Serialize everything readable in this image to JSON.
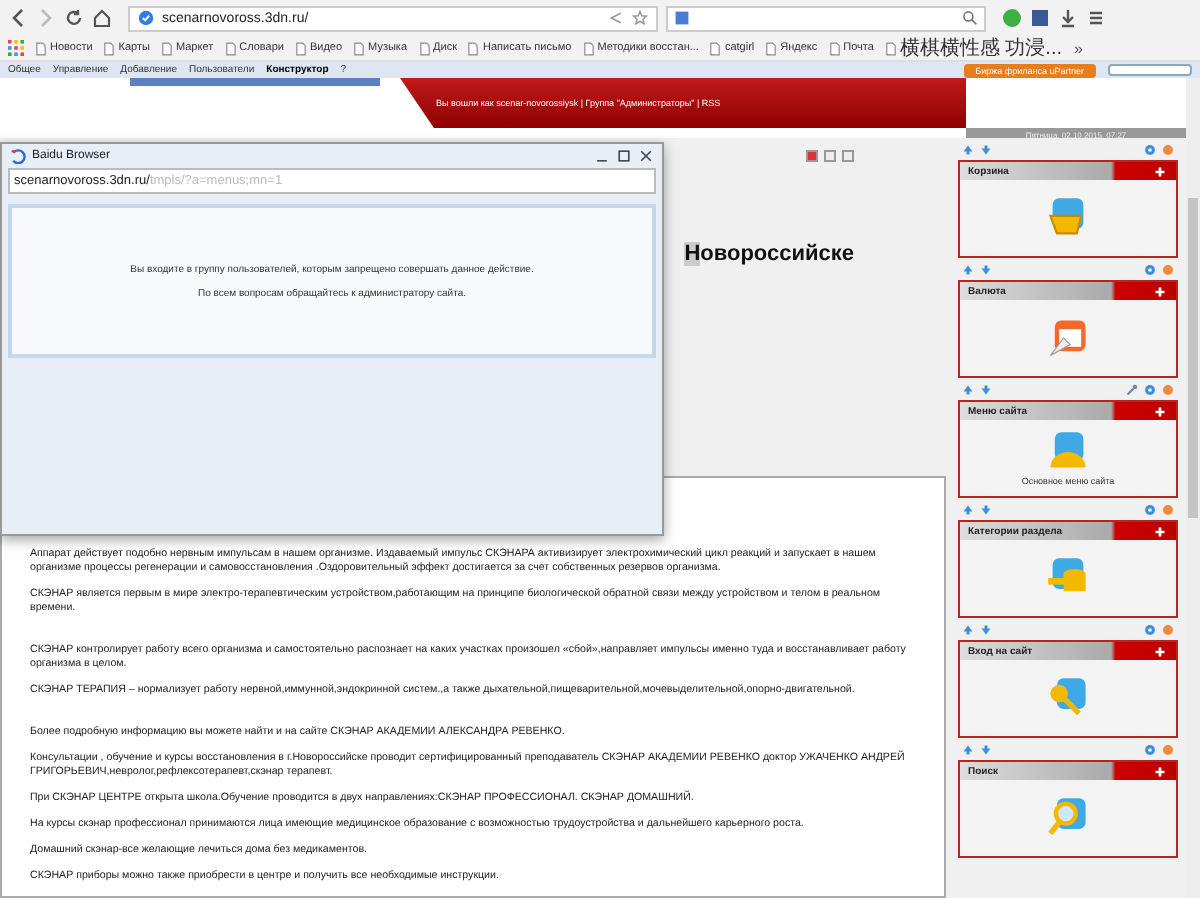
{
  "browser": {
    "url": "scenarnovoross.3dn.ru/",
    "bookmarks": [
      "Новости",
      "Карты",
      "Маркет",
      "Словари",
      "Видео",
      "Музыка",
      "Диск",
      "Написать письмо",
      "Методики восстан...",
      "catgirl",
      "Яндекс",
      "Почта",
      "横棋横性感 功浸..."
    ],
    "more": "»"
  },
  "admin_bar": {
    "items": [
      {
        "label": "Общее",
        "selected": false
      },
      {
        "label": "Управление",
        "selected": false
      },
      {
        "label": "Добавление",
        "selected": false
      },
      {
        "label": "Пользователи",
        "selected": false
      },
      {
        "label": "Конструктор",
        "selected": true
      },
      {
        "label": "?",
        "selected": false
      }
    ],
    "partner_button": "Биржа фриланса uPartner"
  },
  "site_header": {
    "login_text": "Вы вошли как scenar-novorossiysk | Группа \"Администраторы\" | RSS",
    "date": "Пятница, 02.10.2015, 07:27"
  },
  "heading": "Новороссийске",
  "article": {
    "sections": [
      [
        "Аппарат действует подобно нервным импульсам в нашем организме. Издаваемый импульс СКЭНАРА активизирует электрохимический цикл реакций и запускает в нашем организме процессы регенерации и самовосстановления .Оздоровительный эффект достигается за счет собственных резервов организма.",
        "СКЭНАР является первым в мире электро-терапевтическим устройством,работающим на принципе биологической обратной связи между устройством и телом в реальном времени."
      ],
      [
        "СКЭНАР контролирует работу всего организма и самостоятельно распознает на каких участках произошел «сбой»,направляет импульсы именно туда и восстанавливает работу организма в целом.",
        "СКЭНАР ТЕРАПИЯ – нормализует работу нервной,иммунной,эндокринной систем.,а также дыхательной,пищеварительной,мочевыделительной,опорно-двигательной."
      ],
      [
        "Более подробную информацию вы можете найти и на сайте СКЭНАР АКАДЕМИИ АЛЕКСАНДРА РЕВЕНКО.",
        "Консультации , обучение и курсы восстановления в г.Новороссийске проводит сертифицированный преподаватель СКЭНАР АКАДЕМИИ РЕВЕНКО доктор УЖАЧЕНКО АНДРЕЙ ГРИГОРЬЕВИЧ,невролог,рефлексотерапевт,скэнар терапевт.",
        "При СКЭНАР ЦЕНТРЕ открыта школа.Обучение проводится в двух направлениях:СКЭНАР ПРОФЕССИОНАЛ. СКЭНАР ДОМАШНИЙ.",
        "На курсы скэнар профессионал принимаются лица имеющие медицинское образование с возможностью трудоустройства и дальнейшего карьерного роста.",
        "Домашний скэнар-все желающие лечиться дома без медикаментов.",
        "СКЭНАР приборы можно также приобрести в центре и получить все необходимые инструкции."
      ]
    ]
  },
  "sidebar": {
    "blocks": [
      {
        "title": "Корзина",
        "kind": "basket",
        "editable": false
      },
      {
        "title": "Валюта",
        "kind": "currency",
        "editable": false
      },
      {
        "title": "Меню сайта",
        "kind": "menu",
        "editable": true,
        "caption": "Основное меню сайта"
      },
      {
        "title": "Категории раздела",
        "kind": "categories",
        "editable": false
      },
      {
        "title": "Вход на сайт",
        "kind": "login",
        "editable": false
      },
      {
        "title": "Поиск",
        "kind": "search",
        "editable": false
      }
    ]
  },
  "dialog": {
    "title": "Baidu Browser",
    "url": "scenarnovoross.3dn.ru/",
    "url_path": "tmpls/?a=menus;mn=1",
    "messages": [
      "Вы входите в группу пользователей, которым запрещено совершать данное действие.",
      "По всем вопросам обращайтесь к администратору сайта."
    ]
  }
}
